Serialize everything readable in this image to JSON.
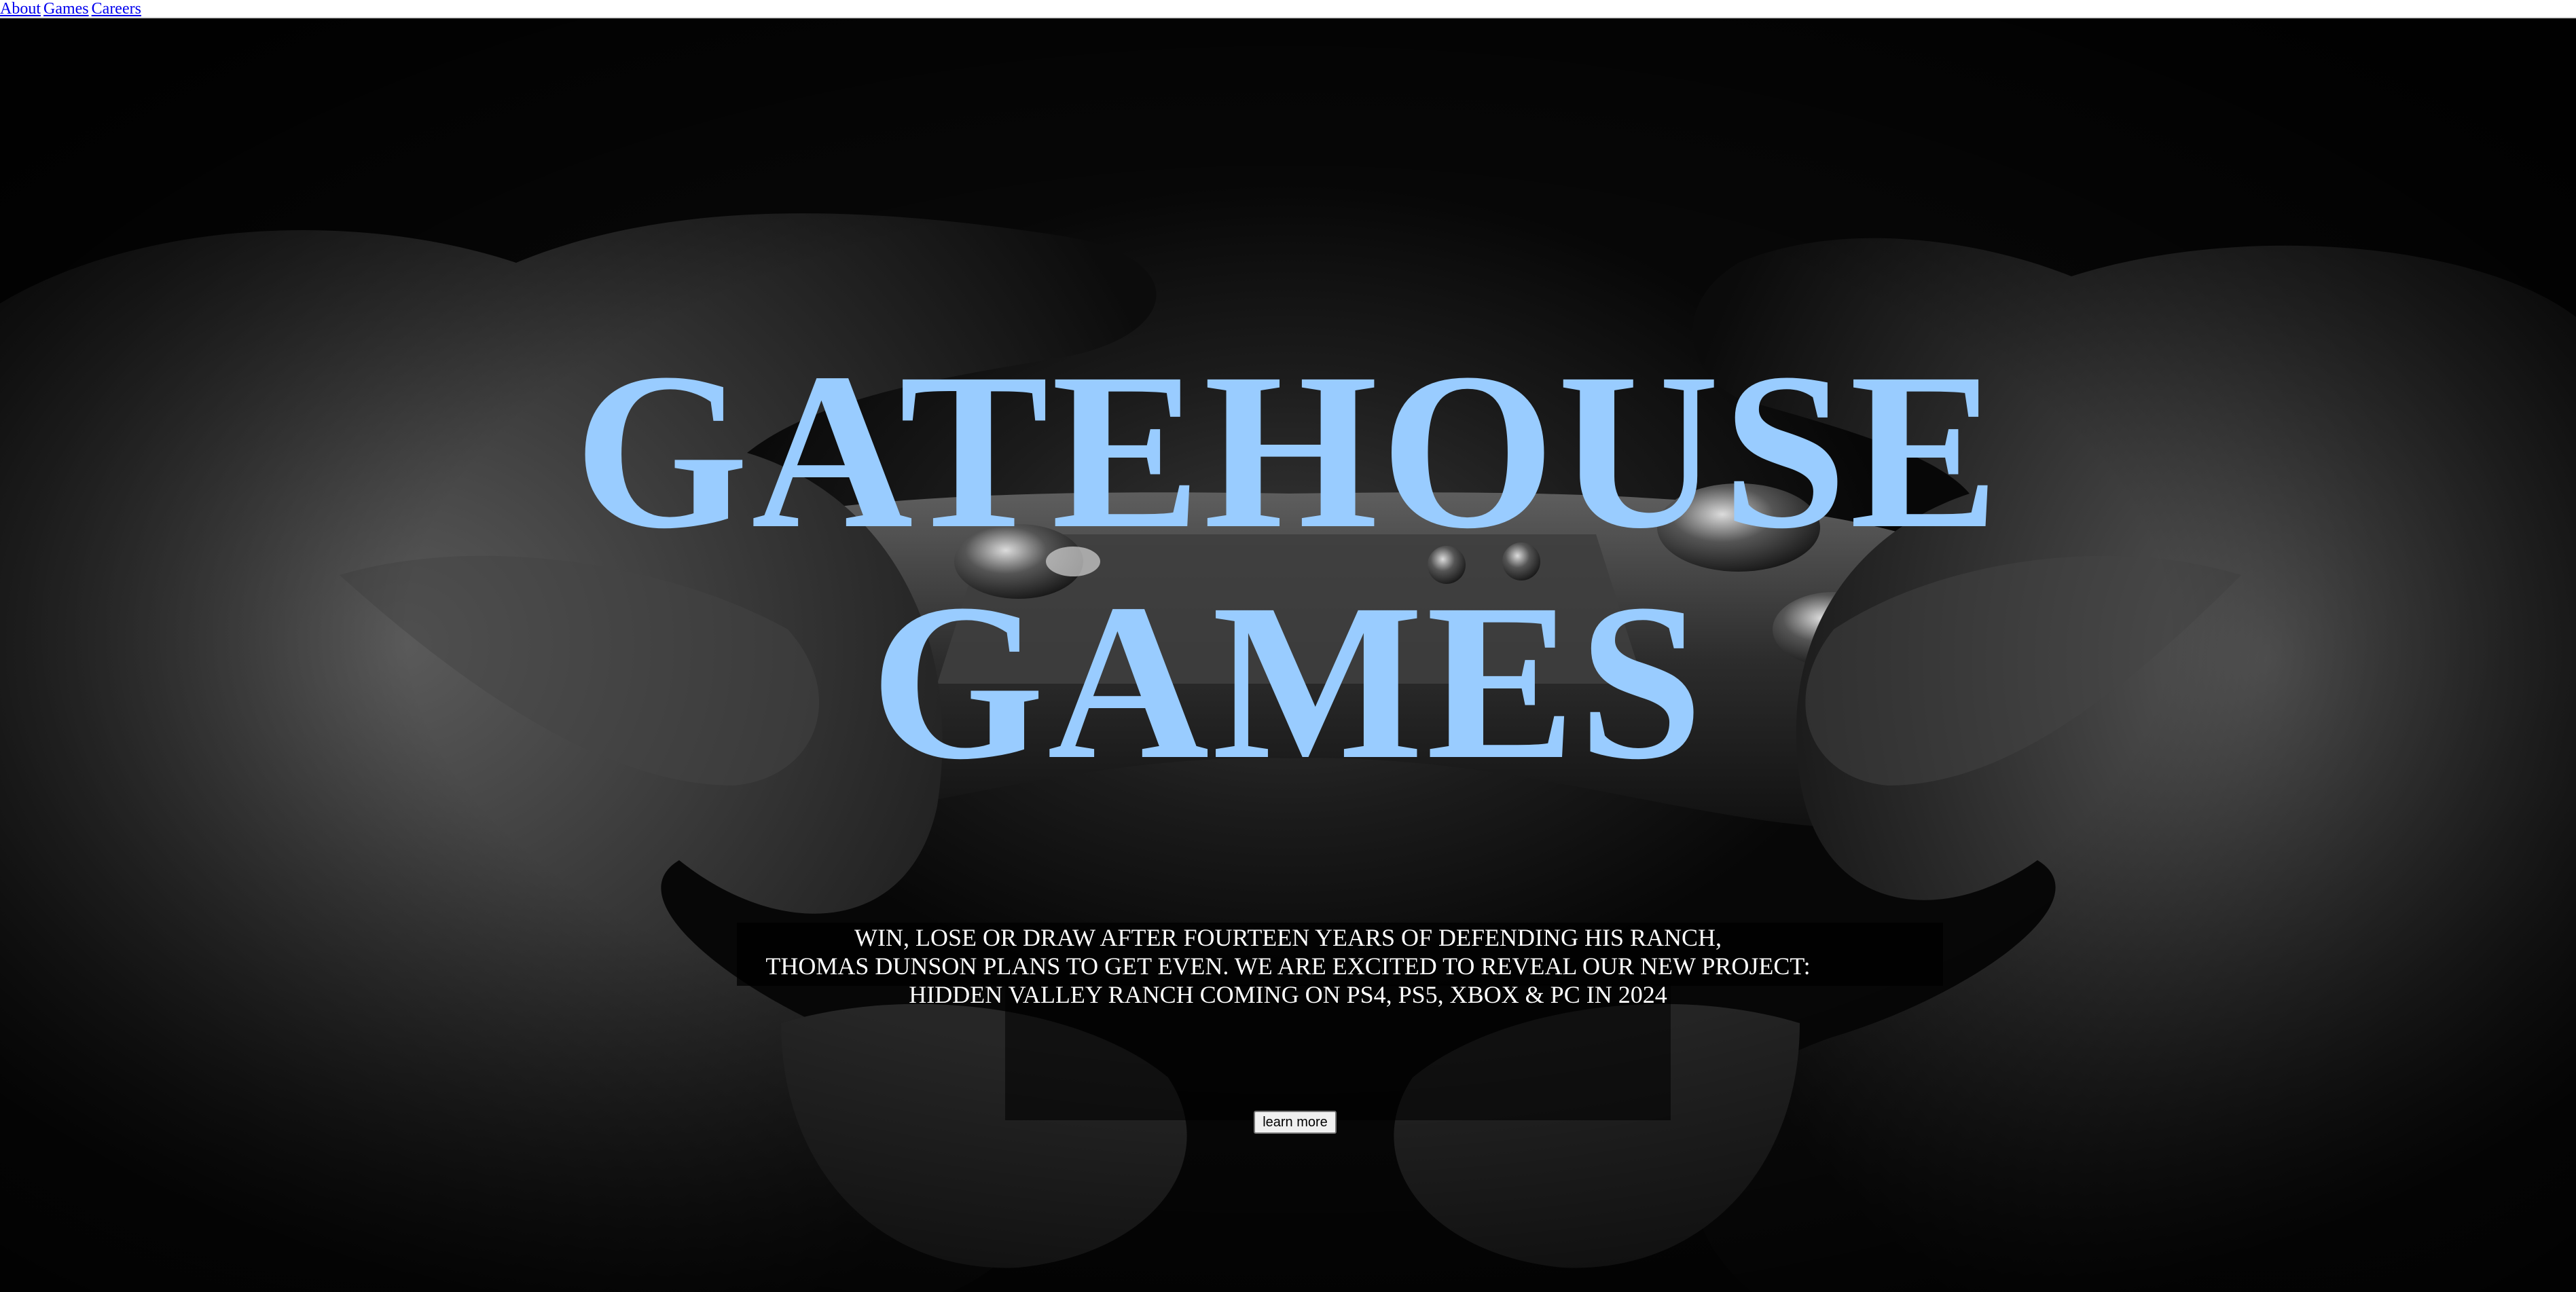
{
  "nav": {
    "links": [
      "About",
      "Games",
      "Careers"
    ]
  },
  "hero": {
    "title_line1": "GATEHOUSE",
    "title_line2": "GAMES",
    "tagline": [
      "WIN, LOSE OR DRAW AFTER FOURTEEN YEARS OF DEFENDING HIS RANCH,",
      "THOMAS DUNSON PLANS TO GET EVEN. WE ARE EXCITED TO REVEAL OUR NEW PROJECT:",
      "HIDDEN VALLEY RANCH COMING ON PS4, PS5, XBOX & PC IN 2024"
    ],
    "cta_label": "learn more"
  },
  "colors": {
    "title": "#99ccff",
    "link": "#0000ee",
    "background": "#000000",
    "tagline": "#ffffff"
  },
  "icons": {
    "background_image": "hands-holding-game-controller-photo"
  }
}
